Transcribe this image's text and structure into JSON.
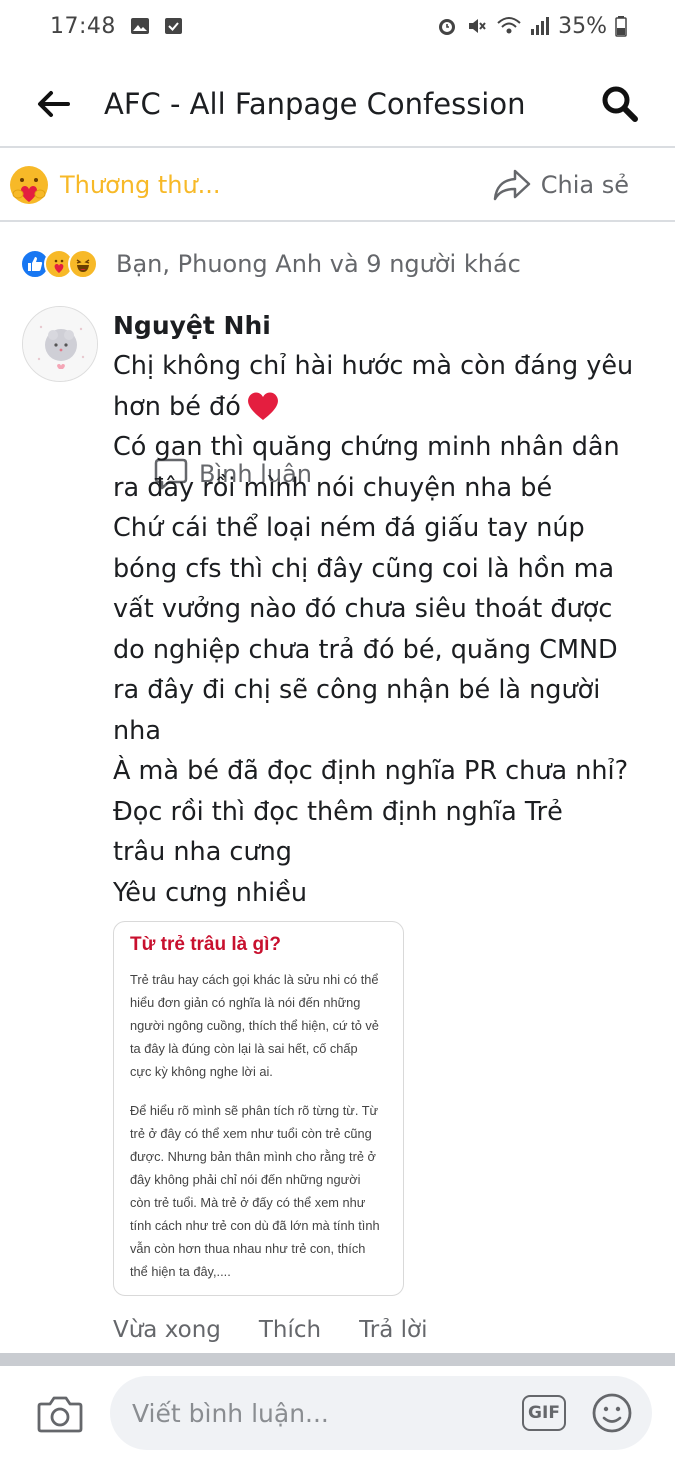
{
  "status_bar": {
    "time": "17:48",
    "battery": "35%"
  },
  "header": {
    "title": "AFC - All Fanpage Confession"
  },
  "actions": {
    "care_label": "Thương thư...",
    "comment_label": "Bình luận",
    "share_label": "Chia sẻ"
  },
  "reactions": {
    "summary": "Bạn, Phuong Anh và 9 người khác"
  },
  "comment": {
    "author": "Nguyệt Nhi",
    "lines": [
      "Chị không chỉ hài hước mà còn đáng yêu",
      "hơn bé đó",
      "Có gan thì quăng chứng minh nhân dân",
      "ra đây rồi mình nói chuyện nha bé",
      "Chứ cái thể loại ném đá giấu tay núp",
      "bóng cfs thì chị đây cũng coi là hồn ma",
      "vất vưởng nào đó chưa siêu thoát được",
      "do nghiệp chưa trả đó bé, quăng CMND",
      "ra đây đi chị sẽ công nhận bé là người",
      "nha",
      "À mà bé đã đọc định nghĩa PR chưa nhỉ?",
      "Đọc rồi thì đọc thêm định nghĩa Trẻ",
      "trâu nha cưng",
      "Yêu cưng nhiều"
    ],
    "image": {
      "title": "Từ trẻ trâu là gì?",
      "para1": [
        "Trẻ trâu hay cách gọi khác là sửu nhi có thể",
        "hiểu đơn giản có nghĩa là nói đến những",
        "người ngông cuồng, thích thể hiện, cứ tỏ vẻ",
        "ta đây là đúng còn lại là sai hết, cố chấp",
        "cực kỳ không nghe lời ai."
      ],
      "para2": [
        "Để hiểu rõ mình sẽ phân tích rõ từng từ. Từ",
        "trẻ ở đây có thể xem như tuổi còn trẻ cũng",
        "được. Nhưng bản thân mình cho rằng trẻ ở",
        "đây không phải chỉ nói đến những người",
        "còn trẻ tuổi. Mà trẻ ở đấy có thể xem như",
        "tính cách như trẻ con dù đã lớn mà tính tình",
        "vẫn còn hơn thua nhau như trẻ con, thích",
        "thể hiện ta đây,...."
      ]
    },
    "footer": {
      "time": "Vừa xong",
      "like": "Thích",
      "reply": "Trả lời"
    }
  },
  "composer": {
    "placeholder": "Viết bình luận...",
    "gif_label": "GIF"
  },
  "colors": {
    "care_yellow": "#f7b928",
    "like_blue": "#1877f2",
    "heart_red": "#e41e3f",
    "card_title_red": "#c8102e"
  },
  "icons": [
    "back-arrow-icon",
    "search-icon",
    "care-reaction-icon",
    "comment-icon",
    "share-icon",
    "like-reaction-icon",
    "haha-reaction-icon",
    "heart-emoji-icon",
    "camera-icon",
    "emoji-icon"
  ]
}
